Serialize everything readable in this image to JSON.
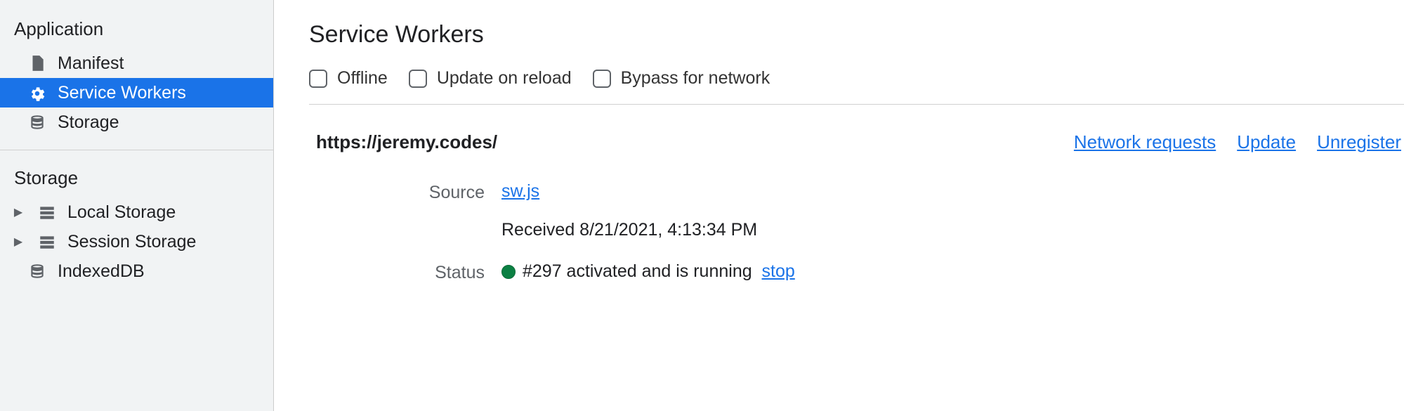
{
  "sidebar": {
    "sections": [
      {
        "heading": "Application",
        "items": [
          {
            "label": "Manifest",
            "icon": "file",
            "selected": false,
            "hasArrow": false
          },
          {
            "label": "Service Workers",
            "icon": "gear",
            "selected": true,
            "hasArrow": false
          },
          {
            "label": "Storage",
            "icon": "db",
            "selected": false,
            "hasArrow": false
          }
        ]
      },
      {
        "heading": "Storage",
        "items": [
          {
            "label": "Local Storage",
            "icon": "grid",
            "selected": false,
            "hasArrow": true
          },
          {
            "label": "Session Storage",
            "icon": "grid",
            "selected": false,
            "hasArrow": true
          },
          {
            "label": "IndexedDB",
            "icon": "db",
            "selected": false,
            "hasArrow": false
          }
        ]
      }
    ]
  },
  "main": {
    "title": "Service Workers",
    "options": {
      "offline": "Offline",
      "updateOnReload": "Update on reload",
      "bypassForNetwork": "Bypass for network"
    },
    "worker": {
      "origin": "https://jeremy.codes/",
      "links": {
        "networkRequests": "Network requests",
        "update": "Update",
        "unregister": "Unregister"
      },
      "labels": {
        "source": "Source",
        "status": "Status"
      },
      "sourceFile": "sw.js",
      "receivedText": "Received 8/21/2021, 4:13:34 PM",
      "statusText": "#297 activated and is running",
      "stopLabel": "stop"
    }
  }
}
